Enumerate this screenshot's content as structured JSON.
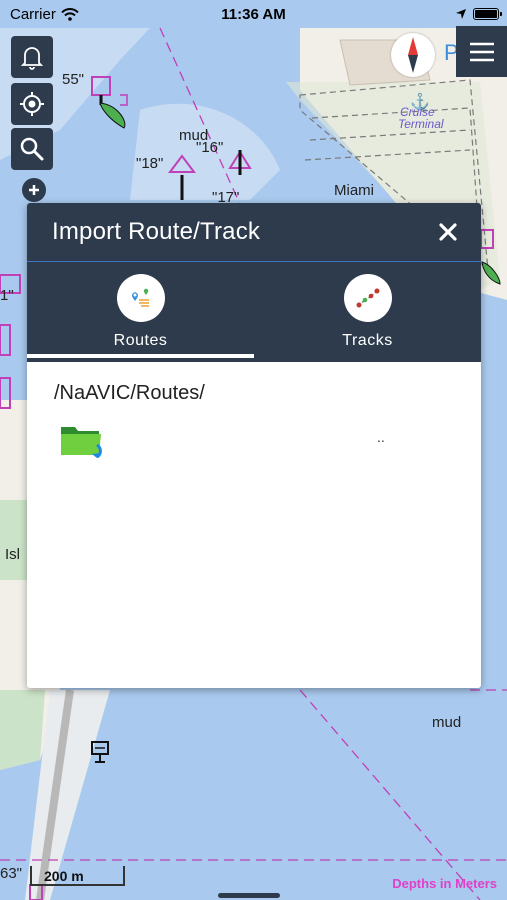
{
  "statusbar": {
    "carrier": "Carrier",
    "time": "11:36 AM"
  },
  "map": {
    "labels": {
      "d55": "55\"",
      "mud1": "mud",
      "d16": "\"16\"",
      "d18": "\"18\"",
      "d17": "\"17\"",
      "miami": "Miami",
      "cruise": "Cruise",
      "terminal": "Terminal",
      "d1": "1\"",
      "isl": "Isl",
      "mud2": "mud",
      "d63": "63\"",
      "p": "P"
    },
    "scale": "200 m",
    "depths_label": "Depths in Meters",
    "colors": {
      "water": "#a9c9ee",
      "land": "#f2efe9",
      "panel": "#2d3b4d",
      "chart_magenta": "#c040b8"
    }
  },
  "controls": {
    "alarm_icon": "bell-icon",
    "locate_icon": "crosshair-icon",
    "search_icon": "search-icon",
    "menu_icon": "hamburger-icon",
    "compass_icon": "compass-icon"
  },
  "dialog": {
    "title": "Import Route/Track",
    "tabs": [
      {
        "label": "Routes",
        "icon": "route-icon",
        "selected": true
      },
      {
        "label": "Tracks",
        "icon": "track-icon",
        "selected": false
      }
    ],
    "path": "/NaAVIC/Routes/",
    "items": [
      {
        "icon": "folder-up-icon",
        "name": ".."
      }
    ]
  }
}
